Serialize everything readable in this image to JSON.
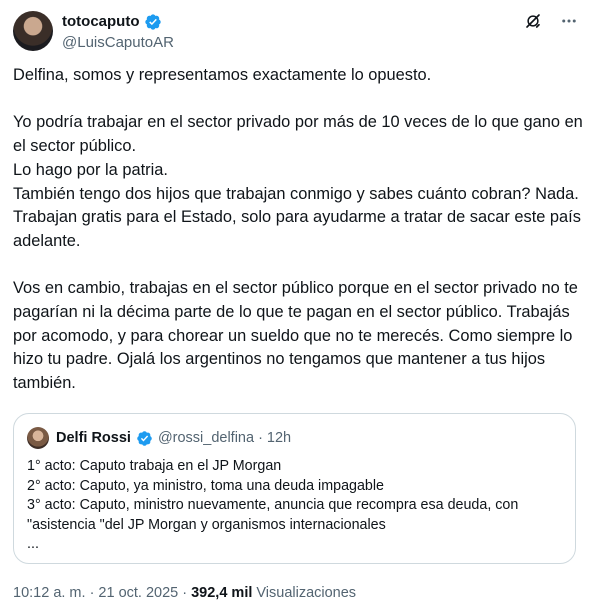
{
  "author": {
    "display_name": "totocaputo",
    "handle": "@LuisCaputoAR"
  },
  "icons": {
    "verified": "verified-badge-icon",
    "grok": "grok-icon",
    "more": "more-options-icon"
  },
  "colors": {
    "verified_blue": "#1d9bf0",
    "secondary_text": "#536471",
    "border": "#cfd9de"
  },
  "tweet": {
    "paragraphs": [
      [
        "Delfina, somos y  representamos exactamente lo opuesto."
      ],
      [
        "Yo podría trabajar en el sector privado por más de 10 veces de lo que gano en el sector público.",
        "Lo hago por la patria.",
        "También tengo dos hijos que trabajan conmigo y sabes cuánto cobran? Nada. Trabajan gratis para el Estado, solo para ayudarme a tratar de sacar este país adelante."
      ],
      [
        "Vos en cambio, trabajas en el sector público porque en el sector privado no te pagarían ni la décima parte de lo que te pagan en el sector público. Trabajás por acomodo, y para chorear un sueldo que no te merecés. Como siempre lo hizo tu padre. Ojalá los argentinos no tengamos que mantener a tus hijos también."
      ]
    ]
  },
  "quote": {
    "display_name": "Delfi Rossi",
    "handle": "@rossi_delfina",
    "separator": "·",
    "time": "12h",
    "lines": [
      "1° acto: Caputo trabaja en el JP Morgan",
      "2° acto: Caputo, ya ministro, toma una deuda impagable",
      "3° acto: Caputo, ministro nuevamente, anuncia que recompra esa deuda, con \"asistencia \"del JP Morgan y organismos internacionales",
      "..."
    ]
  },
  "meta": {
    "timestamp": "10:12 a. m. · 21 oct. 2025 ·",
    "views_count": "392,4 mil",
    "views_label": "Visualizaciones"
  }
}
